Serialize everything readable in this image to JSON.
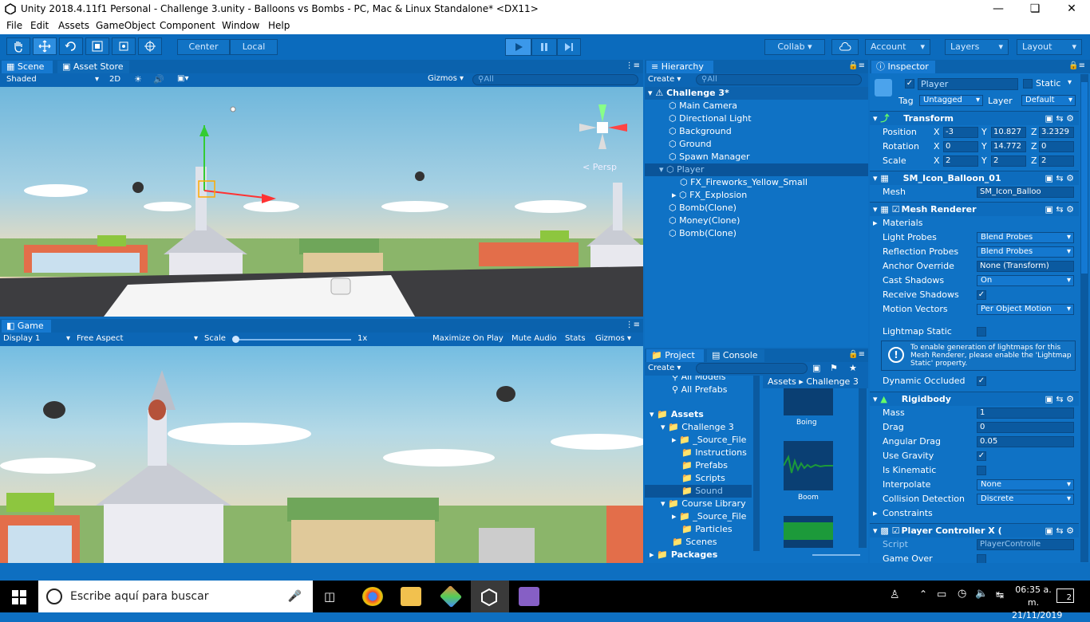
{
  "window": {
    "title": "Unity 2018.4.11f1 Personal - Challenge 3.unity - Balloons vs Bombs - PC, Mac & Linux Standalone* <DX11>"
  },
  "menu": [
    "File",
    "Edit",
    "Assets",
    "GameObject",
    "Component",
    "Window",
    "Help"
  ],
  "toolbar": {
    "center": "Center",
    "local": "Local",
    "collab": "Collab",
    "account": "Account",
    "layers": "Layers",
    "layout": "Layout"
  },
  "scene": {
    "tab_scene": "Scene",
    "tab_store": "Asset Store",
    "shaded": "Shaded",
    "mode_2d": "2D",
    "gizmos": "Gizmos",
    "search": "All",
    "persp": "Persp"
  },
  "game": {
    "tab": "Game",
    "display": "Display 1",
    "aspect": "Free Aspect",
    "scale": "Scale",
    "scale_val": "1x",
    "maximize": "Maximize On Play",
    "mute": "Mute Audio",
    "stats": "Stats",
    "gizmos": "Gizmos"
  },
  "hierarchy": {
    "tab": "Hierarchy",
    "create": "Create",
    "search": "All",
    "scene": "Challenge 3*",
    "items": [
      "Main Camera",
      "Directional Light",
      "Background",
      "Ground",
      "Spawn Manager",
      "Player",
      "FX_Fireworks_Yellow_Small",
      "FX_Explosion",
      "Bomb(Clone)",
      "Money(Clone)",
      "Bomb(Clone)"
    ]
  },
  "project": {
    "tab_project": "Project",
    "tab_console": "Console",
    "create": "Create",
    "tree": [
      "All Models",
      "All Prefabs",
      "Assets",
      "Challenge 3",
      "_Source_File",
      "Instructions",
      "Prefabs",
      "Scripts",
      "Sound",
      "Course Library",
      "_Source_File",
      "Particles",
      "Scenes",
      "Packages"
    ],
    "breadcrumb": [
      "Assets",
      "Challenge 3"
    ],
    "files": [
      "Boing",
      "Boom"
    ]
  },
  "inspector": {
    "tab": "Inspector",
    "name": "Player",
    "static": "Static",
    "tag_label": "Tag",
    "tag": "Untagged",
    "layer_label": "Layer",
    "layer": "Default",
    "transform": {
      "title": "Transform",
      "position": "Position",
      "rotation": "Rotation",
      "scale": "Scale",
      "px": "-3",
      "py": "10.827",
      "pz": "3.2329",
      "rx": "0",
      "ry": "14.772",
      "rz": "0",
      "sx": "2",
      "sy": "2",
      "sz": "2"
    },
    "mesh_filter": {
      "title": "SM_Icon_Balloon_01",
      "mesh_label": "Mesh",
      "mesh": "SM_Icon_Balloo"
    },
    "renderer": {
      "title": "Mesh Renderer",
      "materials": "Materials",
      "light_probes": "Light Probes",
      "light_probes_v": "Blend Probes",
      "refl": "Reflection Probes",
      "refl_v": "Blend Probes",
      "anchor": "Anchor Override",
      "anchor_v": "None (Transform)",
      "cast": "Cast Shadows",
      "cast_v": "On",
      "receive": "Receive Shadows",
      "motion": "Motion Vectors",
      "motion_v": "Per Object Motion",
      "lightmap": "Lightmap Static",
      "info": "To enable generation of lightmaps for this Mesh Renderer, please enable the 'Lightmap Static' property.",
      "dyn": "Dynamic Occluded"
    },
    "rigidbody": {
      "title": "Rigidbody",
      "mass": "Mass",
      "mass_v": "1",
      "drag": "Drag",
      "drag_v": "0",
      "adrag": "Angular Drag",
      "adrag_v": "0.05",
      "grav": "Use Gravity",
      "kin": "Is Kinematic",
      "interp": "Interpolate",
      "interp_v": "None",
      "coll": "Collision Detection",
      "coll_v": "Discrete",
      "constraints": "Constraints"
    },
    "script": {
      "title": "Player Controller X (",
      "script_label": "Script",
      "script_v": "PlayerControlle",
      "gameover": "Game Over"
    }
  },
  "taskbar": {
    "search": "Escribe aquí para buscar",
    "time": "06:35 a. m.",
    "date": "21/11/2019",
    "notif": "2"
  }
}
